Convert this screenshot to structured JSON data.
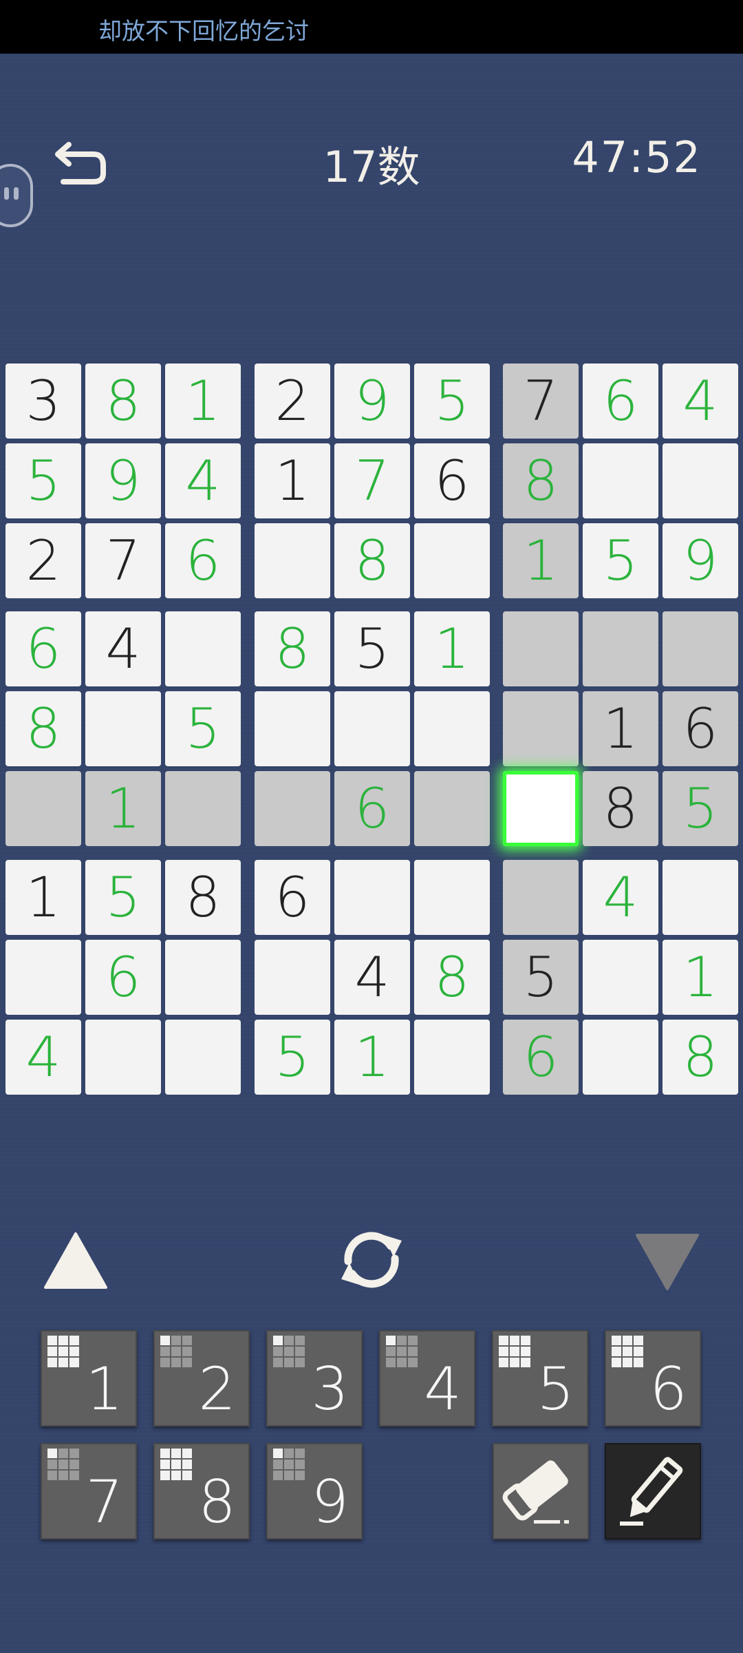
{
  "status_bar": {
    "ticker_text": "却放不下回忆的乞讨"
  },
  "header": {
    "title": "17数",
    "timer": "47:52"
  },
  "board": {
    "cells": [
      [
        "3",
        "8",
        "1",
        "2",
        "9",
        "5",
        "7",
        "6",
        "4"
      ],
      [
        "5",
        "9",
        "4",
        "1",
        "7",
        "6",
        "8",
        "",
        ""
      ],
      [
        "2",
        "7",
        "6",
        "",
        "8",
        "",
        "1",
        "5",
        "9"
      ],
      [
        "6",
        "4",
        "",
        "8",
        "5",
        "1",
        "",
        "",
        ""
      ],
      [
        "8",
        "",
        "5",
        "",
        "",
        "",
        "",
        "1",
        "6"
      ],
      [
        "",
        "1",
        "",
        "",
        "6",
        "",
        "",
        "8",
        "5"
      ],
      [
        "1",
        "5",
        "8",
        "6",
        "",
        "",
        "",
        "4",
        ""
      ],
      [
        "",
        "6",
        "",
        "",
        "4",
        "8",
        "5",
        "",
        "1"
      ],
      [
        "4",
        "",
        "",
        "5",
        "1",
        "",
        "6",
        "",
        "8"
      ]
    ],
    "kinds": [
      [
        "g",
        "u",
        "u",
        "g",
        "u",
        "u",
        "g",
        "u",
        "u"
      ],
      [
        "u",
        "u",
        "u",
        "g",
        "u",
        "g",
        "u",
        "",
        ""
      ],
      [
        "g",
        "g",
        "u",
        "",
        "u",
        "",
        "u",
        "u",
        "u"
      ],
      [
        "u",
        "g",
        "",
        "u",
        "g",
        "u",
        "",
        "",
        ""
      ],
      [
        "u",
        "",
        "u",
        "",
        "",
        "",
        "",
        "g",
        "g"
      ],
      [
        "",
        "u",
        "",
        "",
        "u",
        "",
        "",
        "g",
        "u"
      ],
      [
        "g",
        "u",
        "g",
        "g",
        "",
        "",
        "",
        "u",
        ""
      ],
      [
        "",
        "u",
        "",
        "",
        "g",
        "u",
        "g",
        "",
        "u"
      ],
      [
        "u",
        "",
        "",
        "u",
        "u",
        "",
        "u",
        "",
        "u"
      ]
    ],
    "selected": [
      5,
      6
    ],
    "colors": {
      "given": "#222222",
      "user": "#2bb33c",
      "cell_bg": "#f3f3f3",
      "highlight_bg": "#c9c9c9",
      "select_glow": "#39ff39"
    }
  },
  "controls": {
    "up_icon": "triangle-up-icon",
    "refresh_icon": "refresh-icon",
    "down_icon": "triangle-down-icon"
  },
  "keypad": {
    "keys": [
      {
        "label": "1",
        "pattern": [
          1,
          1,
          1,
          1,
          1,
          1,
          1,
          1,
          1
        ]
      },
      {
        "label": "2",
        "pattern": [
          1,
          0,
          0,
          0,
          0,
          0,
          0,
          0,
          0
        ]
      },
      {
        "label": "3",
        "pattern": [
          1,
          0,
          0,
          0,
          0,
          0,
          0,
          0,
          0
        ]
      },
      {
        "label": "4",
        "pattern": [
          1,
          0,
          0,
          0,
          0,
          0,
          0,
          0,
          0
        ]
      },
      {
        "label": "5",
        "pattern": [
          1,
          1,
          1,
          1,
          1,
          1,
          1,
          1,
          1
        ]
      },
      {
        "label": "6",
        "pattern": [
          1,
          1,
          1,
          1,
          1,
          1,
          1,
          1,
          1
        ]
      },
      {
        "label": "7",
        "pattern": [
          1,
          0,
          0,
          0,
          0,
          0,
          0,
          0,
          0
        ]
      },
      {
        "label": "8",
        "pattern": [
          1,
          1,
          1,
          1,
          1,
          1,
          1,
          1,
          1
        ]
      },
      {
        "label": "9",
        "pattern": [
          1,
          0,
          0,
          0,
          0,
          0,
          0,
          0,
          0
        ]
      }
    ],
    "eraser_icon": "eraser-icon",
    "pencil_icon": "pencil-icon"
  }
}
